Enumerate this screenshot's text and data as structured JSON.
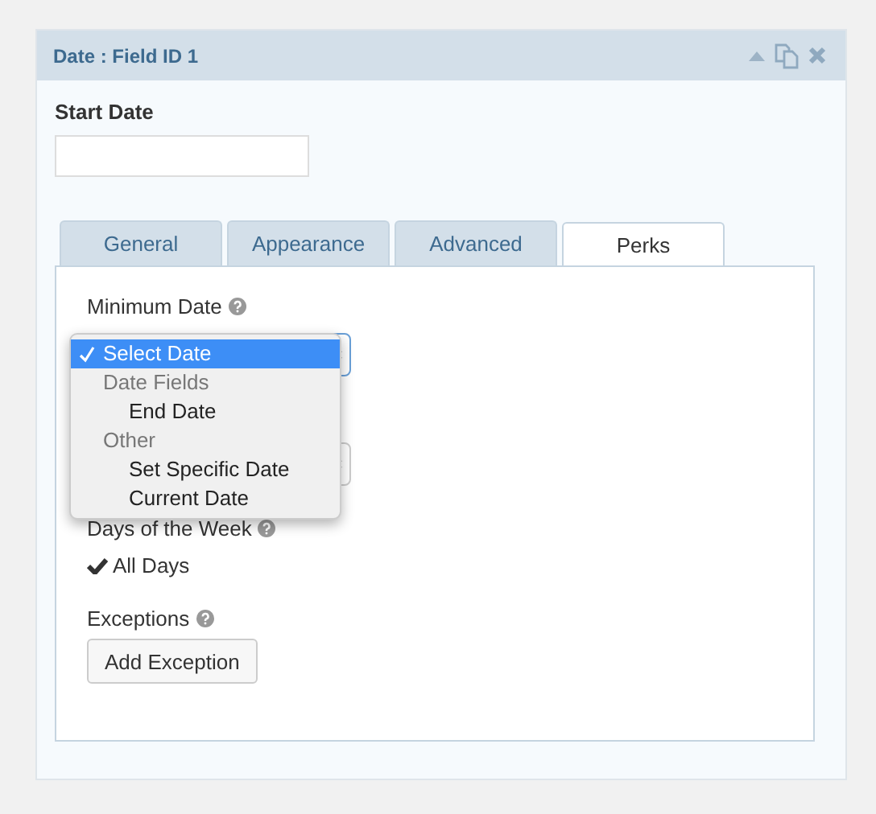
{
  "panel": {
    "title": "Date : Field ID 1"
  },
  "field": {
    "label": "Start Date"
  },
  "tabs": [
    {
      "label": "General",
      "selected": false
    },
    {
      "label": "Appearance",
      "selected": false
    },
    {
      "label": "Advanced",
      "selected": false
    },
    {
      "label": "Perks",
      "selected": true
    }
  ],
  "minimum_date": {
    "label": "Minimum Date",
    "menu": [
      {
        "kind": "option",
        "label": "Select Date",
        "selected": true
      },
      {
        "kind": "group",
        "label": "Date Fields",
        "children": [
          {
            "label": "End Date",
            "selected": false
          }
        ]
      },
      {
        "kind": "group",
        "label": "Other",
        "children": [
          {
            "label": "Set Specific Date",
            "selected": false
          },
          {
            "label": "Current Date",
            "selected": false
          }
        ]
      }
    ]
  },
  "days_of_week": {
    "label": "Days of the Week",
    "value": "All Days",
    "checked": true
  },
  "exceptions": {
    "label": "Exceptions",
    "button": "Add Exception"
  }
}
